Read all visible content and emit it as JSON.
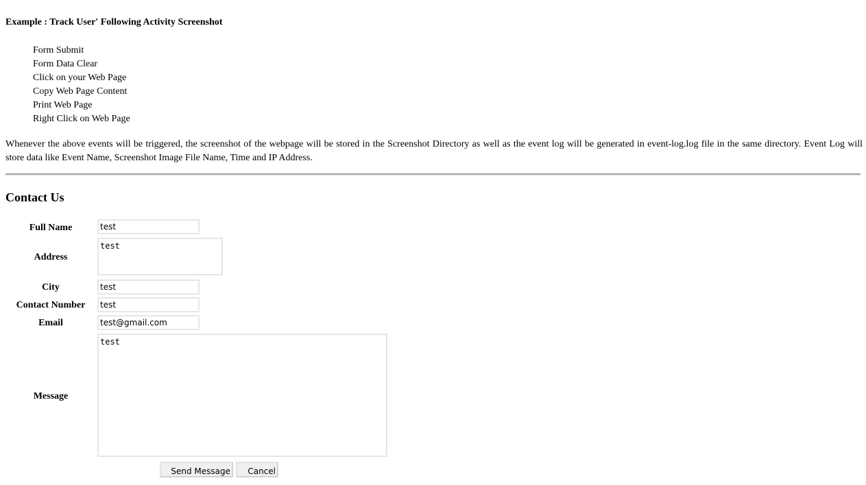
{
  "example": {
    "heading": "Example : Track User' Following Activity Screenshot",
    "events": [
      "Form Submit",
      "Form Data Clear",
      "Click on your Web Page",
      "Copy Web Page Content",
      "Print Web Page",
      "Right Click on Web Page"
    ],
    "description": "Whenever the above events will be triggered, the screenshot of the webpage will be stored in the Screenshot Directory as well as the event log will be generated in event-log.log file in the same directory. Event Log will store data like Event Name, Screenshot Image File Name, Time and IP Address."
  },
  "contact": {
    "title": "Contact Us",
    "fields": {
      "full_name": {
        "label": "Full Name",
        "value": "test"
      },
      "address": {
        "label": "Address",
        "value": "test"
      },
      "city": {
        "label": "City",
        "value": "test"
      },
      "contact_number": {
        "label": "Contact Number",
        "value": "test"
      },
      "email": {
        "label": "Email",
        "value": "test@gmail.com"
      },
      "message": {
        "label": "Message",
        "value": "test"
      }
    },
    "buttons": {
      "send": "Send Message",
      "cancel": "Cancel"
    }
  }
}
